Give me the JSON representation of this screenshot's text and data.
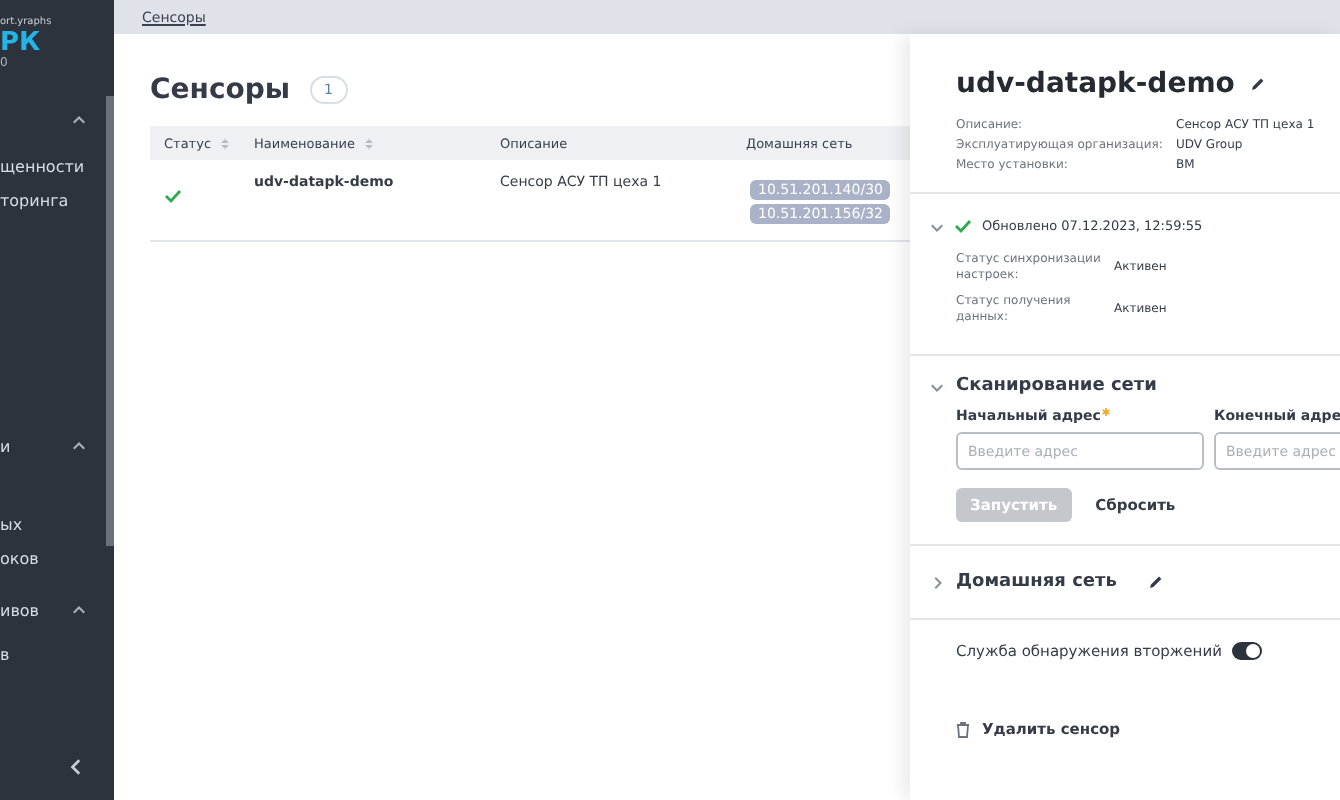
{
  "sidebar": {
    "logo": {
      "tagline": "ort.yraphs",
      "mark": "РК",
      "version": "0"
    },
    "items": [
      {
        "kind": "group",
        "expanded": true
      },
      {
        "kind": "link",
        "label": "щенности"
      },
      {
        "kind": "link",
        "label": "торинга"
      },
      {
        "kind": "group",
        "label": "и",
        "expanded": true
      },
      {
        "kind": "link",
        "label": "ых"
      },
      {
        "kind": "link",
        "label": "оков"
      },
      {
        "kind": "group",
        "label": "ивов",
        "expanded": true
      },
      {
        "kind": "link",
        "label": "в"
      }
    ]
  },
  "breadcrumb": "Сенсоры",
  "page": {
    "title": "Сенсоры",
    "count": "1"
  },
  "table": {
    "columns": [
      {
        "label": "Статус",
        "sortable": true
      },
      {
        "label": "Наименование",
        "sortable": true
      },
      {
        "label": "Описание",
        "sortable": false
      },
      {
        "label": "Домашняя сеть",
        "sortable": false
      }
    ],
    "rows": [
      {
        "ok": true,
        "name": "udv-datapk-demo",
        "description": "Сенсор АСУ ТП цеха 1",
        "networks": [
          "10.51.201.140/30",
          "10.51.201.156/32"
        ]
      }
    ]
  },
  "panel": {
    "title": "udv-datapk-demo",
    "properties": [
      {
        "label": "Описание:",
        "value": "Сенсор АСУ ТП цеха 1"
      },
      {
        "label": "Эксплуатирующая организация:",
        "value": "UDV Group"
      },
      {
        "label": "Место установки:",
        "value": "ВМ"
      }
    ],
    "status": {
      "expanded": true,
      "ok": true,
      "updated": "Обновлено 07.12.2023, 12:59:55",
      "rows": [
        {
          "label": "Статус синхронизации настроек:",
          "value": "Активен"
        },
        {
          "label": "Статус получения данных:",
          "value": "Активен"
        }
      ]
    },
    "scan": {
      "title": "Сканирование сети",
      "expanded": true,
      "fields": [
        {
          "label": "Начальный адрес",
          "required": true,
          "placeholder": "Введите адрес"
        },
        {
          "label": "Конечный адре",
          "required": false,
          "placeholder": "Введите адрес"
        }
      ],
      "run": {
        "label": "Запустить",
        "disabled": true
      },
      "reset": "Сбросить"
    },
    "home_network": {
      "title": "Домашняя сеть",
      "expanded": false
    },
    "ids": {
      "label": "Служба обнаружения вторжений",
      "on": true
    },
    "delete": "Удалить сенсор"
  }
}
